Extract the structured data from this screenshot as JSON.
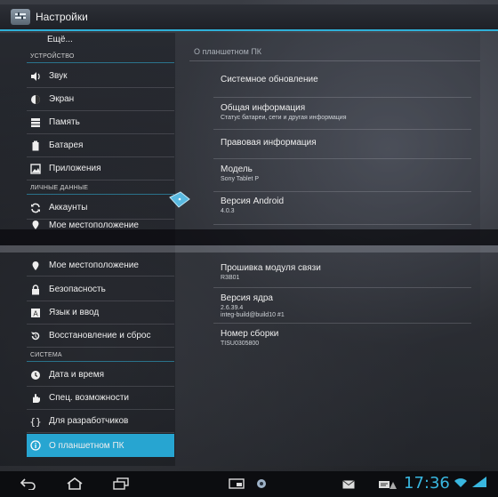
{
  "app": {
    "title": "Настройки"
  },
  "sidebar": {
    "more_label": "Ещё...",
    "sections": [
      {
        "label": "УСТРОЙСТВО"
      },
      {
        "label": "ЛИЧНЫЕ ДАННЫЕ"
      },
      {
        "label": "СИСТЕМА"
      }
    ],
    "items": [
      {
        "label": "Звук",
        "icon": "volume-icon"
      },
      {
        "label": "Экран",
        "icon": "brightness-icon"
      },
      {
        "label": "Память",
        "icon": "storage-icon"
      },
      {
        "label": "Батарея",
        "icon": "battery-icon"
      },
      {
        "label": "Приложения",
        "icon": "apps-icon"
      },
      {
        "label": "Аккаунты",
        "icon": "sync-icon"
      },
      {
        "label": "Мое местоположение",
        "icon": "location-icon"
      },
      {
        "label": "Безопасность",
        "icon": "lock-icon"
      },
      {
        "label": "Язык и ввод",
        "icon": "language-icon"
      },
      {
        "label": "Восстановление и сброс",
        "icon": "restore-icon"
      },
      {
        "label": "Дата и время",
        "icon": "clock-icon"
      },
      {
        "label": "Спец. возможности",
        "icon": "hand-icon"
      },
      {
        "label": "Для разработчиков",
        "icon": "braces-icon"
      },
      {
        "label": "О планшетном ПК",
        "icon": "info-icon",
        "selected": true
      }
    ],
    "accent": "#27a5d1"
  },
  "detail": {
    "header": "О планшетном ПК",
    "items": [
      {
        "title": "Системное обновление",
        "summary": ""
      },
      {
        "title": "Общая информация",
        "summary": "Статус батареи, сети и другая информация"
      },
      {
        "title": "Правовая информация",
        "summary": ""
      },
      {
        "title": "Модель",
        "summary": "Sony Tablet P"
      },
      {
        "title": "Версия Android",
        "summary": "4.0.3"
      },
      {
        "title": "Прошивка модуля связи",
        "summary": "R3B01"
      },
      {
        "title": "Версия ядра",
        "summary": "2.6.39.4",
        "summary2": "integ-build@build10 #1"
      },
      {
        "title": "Номер сборки",
        "summary": "TISU0305800"
      }
    ]
  },
  "statusbar": {
    "time": "17:36",
    "icons": [
      "back-icon",
      "home-icon",
      "recent-apps-icon",
      "screenshot-icon",
      "app-icon",
      "mail-icon",
      "message-icon",
      "notification-icon",
      "wifi-icon",
      "battery-status-icon"
    ],
    "accent": "#39b7e0"
  }
}
